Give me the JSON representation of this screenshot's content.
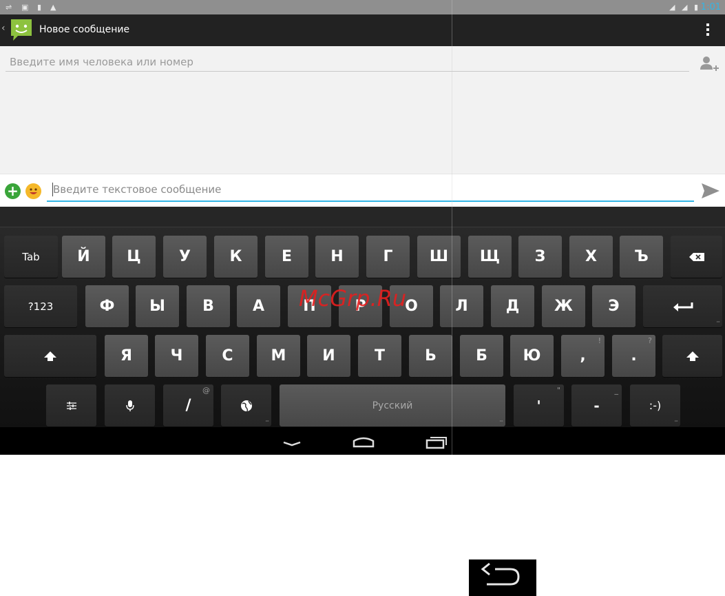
{
  "status_bar": {
    "time": "1:01",
    "left_icons": [
      "usb-icon",
      "gallery-icon",
      "battery-saver-icon",
      "warning-icon"
    ],
    "right_icons": [
      "signal-1-icon",
      "signal-2-icon",
      "battery-icon"
    ]
  },
  "action_bar": {
    "title": "Новое сообщение",
    "app_icon": "messaging-app-icon",
    "menu_icon": "overflow-menu-icon"
  },
  "compose": {
    "recipient_placeholder": "Введите имя человека или номер",
    "message_placeholder": "Введите текстовое сообщение"
  },
  "keyboard": {
    "row1": [
      "Tab",
      "Й",
      "Ц",
      "У",
      "К",
      "Е",
      "Н",
      "Г",
      "Ш",
      "Щ",
      "З",
      "Х",
      "Ъ"
    ],
    "row2": [
      "?123",
      "Ф",
      "Ы",
      "В",
      "А",
      "П",
      "Р",
      "О",
      "Л",
      "Д",
      "Ж",
      "Э"
    ],
    "row3": [
      "Я",
      "Ч",
      "С",
      "М",
      "И",
      "Т",
      "Ь",
      "Б",
      "Ю",
      ",",
      "."
    ],
    "row3_hints": [
      "!",
      "?"
    ],
    "row4": {
      "slash": "/",
      "slash_hint": "@",
      "space_label": "Русский",
      "apostrophe": "'",
      "apostrophe_hint": "\"",
      "dash": "-",
      "dash_hint": "_",
      "smiley": ":-)"
    }
  },
  "watermark": "McGrp.Ru",
  "colors": {
    "accent": "#33b5e5",
    "keyboard_bg": "#1a1a1a",
    "key_letter": "#505050",
    "attach_green": "#3aa53a"
  }
}
